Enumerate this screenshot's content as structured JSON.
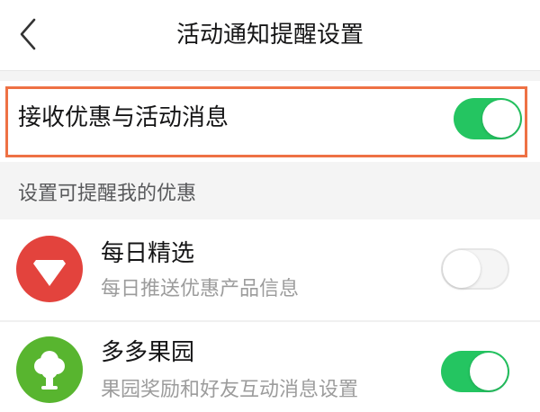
{
  "header": {
    "title": "活动通知提醒设置",
    "back_icon": "chevron-left-icon"
  },
  "receive_setting": {
    "label": "接收优惠与活动消息",
    "enabled": true
  },
  "section": {
    "heading": "设置可提醒我的优惠"
  },
  "items": [
    {
      "title": "每日精选",
      "subtitle": "每日推送优惠产品信息",
      "icon": "diamond-icon",
      "icon_color": "#e3433d",
      "enabled": false
    },
    {
      "title": "多多果园",
      "subtitle": "果园奖励和好友互动消息设置",
      "icon": "tree-icon",
      "icon_color": "#58b52f",
      "enabled": true
    }
  ],
  "colors": {
    "toggle_on": "#24c561",
    "highlight": "#ee7144"
  }
}
